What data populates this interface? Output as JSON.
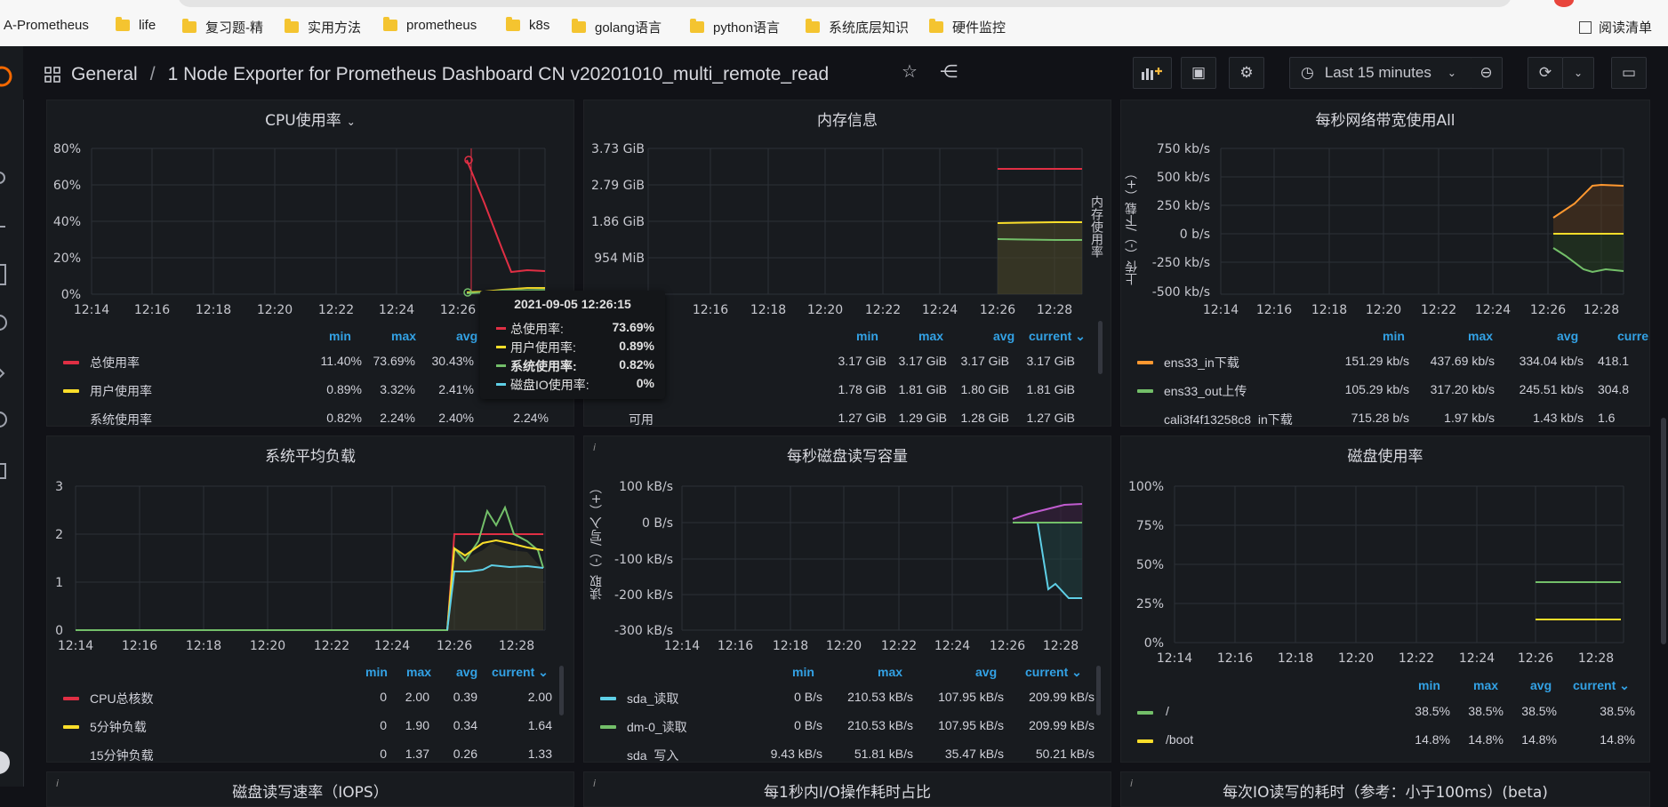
{
  "bookmarks": {
    "items": [
      "A-Prometheus",
      "life",
      "复习题-精",
      "实用方法",
      "prometheus",
      "k8s",
      "golang语言",
      "python语言",
      "系统底层知识",
      "硬件监控"
    ],
    "reading_list": "阅读清单"
  },
  "header": {
    "section": "General",
    "separator": "/",
    "title": "1 Node Exporter for Prometheus Dashboard CN v20201010_multi_remote_read",
    "time_range": "Last 15 minutes"
  },
  "x_ticks": [
    "12:14",
    "12:16",
    "12:18",
    "12:20",
    "12:22",
    "12:24",
    "12:26",
    "12:28"
  ],
  "colors": {
    "red": "#e02f44",
    "yellow": "#fade2a",
    "green": "#73bf69",
    "cyan": "#5ecfe6",
    "orange": "#ff9830",
    "purple": "#c05ccf",
    "blue": "#33a2e5"
  },
  "legend_headers": {
    "min": "min",
    "max": "max",
    "avg": "avg",
    "current": "current"
  },
  "panels": {
    "cpu": {
      "title": "CPU使用率",
      "y_ticks": [
        "80%",
        "60%",
        "40%",
        "20%",
        "0%"
      ],
      "rows": [
        {
          "name": "总使用率",
          "min": "11.40%",
          "max": "73.69%",
          "avg": "30.43%"
        },
        {
          "name": "用户使用率",
          "min": "0.89%",
          "max": "3.32%",
          "avg": "2.41%"
        },
        {
          "name": "系统使用率",
          "min": "0.82%",
          "max": "2.24%",
          "avg": "2.40%",
          "current": "2.24%"
        }
      ]
    },
    "mem": {
      "title": "内存信息",
      "y_ticks": [
        "3.73 GiB",
        "2.79 GiB",
        "1.86 GiB",
        "954 MiB"
      ],
      "right_label": "内存使用率",
      "rows": [
        {
          "name": "",
          "min": "3.17 GiB",
          "max": "3.17 GiB",
          "avg": "3.17 GiB",
          "current": "3.17 GiB"
        },
        {
          "name": "",
          "min": "1.78 GiB",
          "max": "1.81 GiB",
          "avg": "1.80 GiB",
          "current": "1.81 GiB"
        },
        {
          "name": "可用",
          "min": "1.27 GiB",
          "max": "1.29 GiB",
          "avg": "1.28 GiB",
          "current": "1.27 GiB"
        }
      ]
    },
    "net": {
      "title": "每秒网络带宽使用All",
      "y_ticks": [
        "750 kb/s",
        "500 kb/s",
        "250 kb/s",
        "0 b/s",
        "-250 kb/s",
        "-500 kb/s"
      ],
      "y_label": "上传（-）/下载（+）",
      "rows": [
        {
          "name": "ens33_in下载",
          "min": "151.29 kb/s",
          "max": "437.69 kb/s",
          "avg": "334.04 kb/s",
          "current": "418.1"
        },
        {
          "name": "ens33_out上传",
          "min": "105.29 kb/s",
          "max": "317.20 kb/s",
          "avg": "245.51 kb/s",
          "current": "304.8"
        },
        {
          "name": "cali3f4f13258c8_in下载",
          "min": "715.28 b/s",
          "max": "1.97 kb/s",
          "avg": "1.43 kb/s",
          "current": "1.6"
        }
      ]
    },
    "load": {
      "title": "系统平均负载",
      "y_ticks": [
        "3",
        "2",
        "1",
        "0"
      ],
      "rows": [
        {
          "name": "CPU总核数",
          "min": "0",
          "max": "2.00",
          "avg": "0.39",
          "current": "2.00"
        },
        {
          "name": "5分钟负载",
          "min": "0",
          "max": "1.90",
          "avg": "0.34",
          "current": "1.64"
        },
        {
          "name": "15分钟负载",
          "min": "0",
          "max": "1.37",
          "avg": "0.26",
          "current": "1.33"
        }
      ]
    },
    "disk_rw": {
      "title": "每秒磁盘读写容量",
      "y_ticks": [
        "100 kB/s",
        "0 B/s",
        "-100 kB/s",
        "-200 kB/s",
        "-300 kB/s"
      ],
      "y_label": "读取（-）/写入（+）",
      "rows": [
        {
          "name": "sda_读取",
          "min": "0 B/s",
          "max": "210.53 kB/s",
          "avg": "107.95 kB/s",
          "current": "209.99 kB/s"
        },
        {
          "name": "dm-0_读取",
          "min": "0 B/s",
          "max": "210.53 kB/s",
          "avg": "107.95 kB/s",
          "current": "209.99 kB/s"
        },
        {
          "name": "sda_写入",
          "min": "9.43 kB/s",
          "max": "51.81 kB/s",
          "avg": "35.47 kB/s",
          "current": "50.21 kB/s"
        }
      ]
    },
    "disk_usage": {
      "title": "磁盘使用率",
      "y_ticks": [
        "100%",
        "75%",
        "50%",
        "25%",
        "0%"
      ],
      "rows": [
        {
          "name": "/",
          "min": "38.5%",
          "max": "38.5%",
          "avg": "38.5%",
          "current": "38.5%"
        },
        {
          "name": "/boot",
          "min": "14.8%",
          "max": "14.8%",
          "avg": "14.8%",
          "current": "14.8%"
        }
      ]
    },
    "bottom": {
      "titles": [
        "磁盘读写速率（IOPS）",
        "每1秒内I/O操作耗时占比",
        "每次IO读写的耗时（参考：小于100ms）(beta)"
      ]
    }
  },
  "tooltip": {
    "time": "2021-09-05 12:26:15",
    "rows": [
      {
        "name": "总使用率:",
        "value": "73.69%"
      },
      {
        "name": "用户使用率:",
        "value": "0.89%"
      },
      {
        "name": "系统使用率:",
        "value": "0.82%"
      },
      {
        "name": "磁盘IO使用率:",
        "value": "0%"
      }
    ]
  },
  "chart_data": [
    {
      "type": "line",
      "title": "CPU使用率",
      "x": [
        "12:26",
        "12:26:30",
        "12:27",
        "12:27:30",
        "12:28",
        "12:28:30"
      ],
      "series": [
        {
          "name": "总使用率",
          "values": [
            73.69,
            48,
            20,
            12.5,
            12.6,
            12.4
          ]
        },
        {
          "name": "用户使用率",
          "values": [
            0.89,
            1.5,
            2.8,
            3.2,
            3.3,
            3.32
          ]
        },
        {
          "name": "系统使用率",
          "values": [
            0.82,
            1.5,
            2.0,
            2.2,
            2.24,
            2.24
          ]
        }
      ],
      "ylim": [
        0,
        80
      ]
    },
    {
      "type": "line",
      "title": "内存信息",
      "series": [
        {
          "name": "",
          "values": [
            3.17,
            3.17,
            3.17,
            3.17
          ]
        },
        {
          "name": "",
          "values": [
            1.8,
            1.8,
            1.81,
            1.81
          ]
        },
        {
          "name": "可用",
          "values": [
            1.28,
            1.28,
            1.27,
            1.27
          ]
        }
      ],
      "ylim": [
        0,
        3.73
      ]
    },
    {
      "type": "line",
      "title": "每秒网络带宽使用All",
      "series": [
        {
          "name": "ens33_in下载",
          "values": [
            151,
            250,
            330,
            437,
            418,
            418
          ]
        },
        {
          "name": "ens33_out上传",
          "values": [
            -105,
            -180,
            -260,
            -317,
            -300,
            -305
          ]
        }
      ],
      "ylim": [
        -500,
        750
      ]
    },
    {
      "type": "line",
      "title": "系统平均负载",
      "series": [
        {
          "name": "CPU总核数",
          "values": [
            0,
            0,
            2,
            2,
            2,
            2,
            2,
            2
          ]
        },
        {
          "name": "5分钟负载",
          "values": [
            0,
            0,
            1.7,
            1.75,
            1.9,
            1.72,
            1.8,
            1.64
          ]
        },
        {
          "name": "15分钟负载",
          "values": [
            0,
            0,
            1.25,
            1.25,
            1.35,
            1.35,
            1.34,
            1.33
          ]
        }
      ],
      "ylim": [
        0,
        3
      ]
    },
    {
      "type": "line",
      "title": "每秒磁盘读写容量",
      "series": [
        {
          "name": "sda_读取",
          "values": [
            0,
            0,
            -190,
            -210,
            -210
          ]
        },
        {
          "name": "sda_写入",
          "values": [
            9.4,
            30,
            42,
            50,
            51
          ]
        }
      ],
      "ylim": [
        -300,
        100
      ]
    },
    {
      "type": "line",
      "title": "磁盘使用率",
      "series": [
        {
          "name": "/",
          "values": [
            38.5,
            38.5
          ]
        },
        {
          "name": "/boot",
          "values": [
            14.8,
            14.8
          ]
        }
      ],
      "ylim": [
        0,
        100
      ]
    }
  ]
}
